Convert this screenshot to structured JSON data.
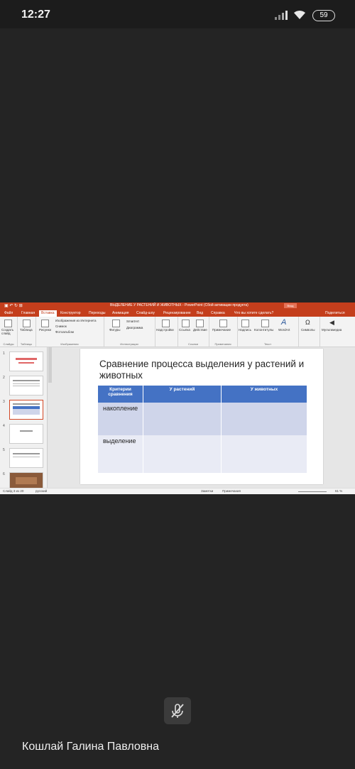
{
  "status_bar": {
    "time": "12:27",
    "battery": "59"
  },
  "ppt": {
    "title": "ВЫДЕЛЕНИЕ У РАСТЕНИЙ И ЖИВОТНЫХ  -  PowerPoint (Сбой активации продукта)",
    "login_label": "Вход",
    "tabs": [
      "Файл",
      "Главная",
      "Вставка",
      "Конструктор",
      "Переходы",
      "Анимация",
      "Слайд-шоу",
      "Рецензирование",
      "Вид",
      "Справка",
      "Что вы хотите сделать?",
      "Поделиться"
    ],
    "active_tab": "Вставка",
    "ribbon_groups": [
      "Слайды",
      "Таблицы",
      "Изображения",
      "Иллюстрации",
      "Ссылки",
      "Примечания",
      "Текст"
    ],
    "ribbon_items": {
      "new_slide": "Создать слайд",
      "table": "Таблица",
      "pictures": "Рисунки",
      "online_pictures": "Изображения из Интернета",
      "screenshot": "Снимок",
      "album": "Фотоальбом",
      "shapes": "Фигуры",
      "smartart": "SmartArt",
      "chart": "Диаграмма",
      "addins": "Надстройки",
      "link": "Ссылка",
      "action": "Действие",
      "comment": "Примечание",
      "textbox": "Надпись",
      "header_footer": "Колонтитулы",
      "wordart": "WordArt",
      "symbols": "Символы",
      "media": "Мультимедиа"
    },
    "thumbnail_numbers": [
      "1",
      "2",
      "3",
      "4",
      "5",
      "6"
    ],
    "slide": {
      "title": "Сравнение процесса выделения у растений и животных",
      "table": {
        "headers": [
          "Критерии сравнения",
          "У растений",
          "У животных"
        ],
        "rows": [
          [
            "накопление",
            "",
            ""
          ],
          [
            "выделение",
            "",
            ""
          ]
        ]
      }
    },
    "statusbar": {
      "slide_info": "Слайд 3 из 20",
      "language": "русский",
      "notes": "Заметки",
      "comments": "Примечания",
      "zoom": "61 %"
    }
  },
  "participant": {
    "name": "Кошлай Галина Павловна"
  },
  "colors": {
    "ppt_accent": "#c43e1c",
    "table_header": "#4472c4"
  }
}
